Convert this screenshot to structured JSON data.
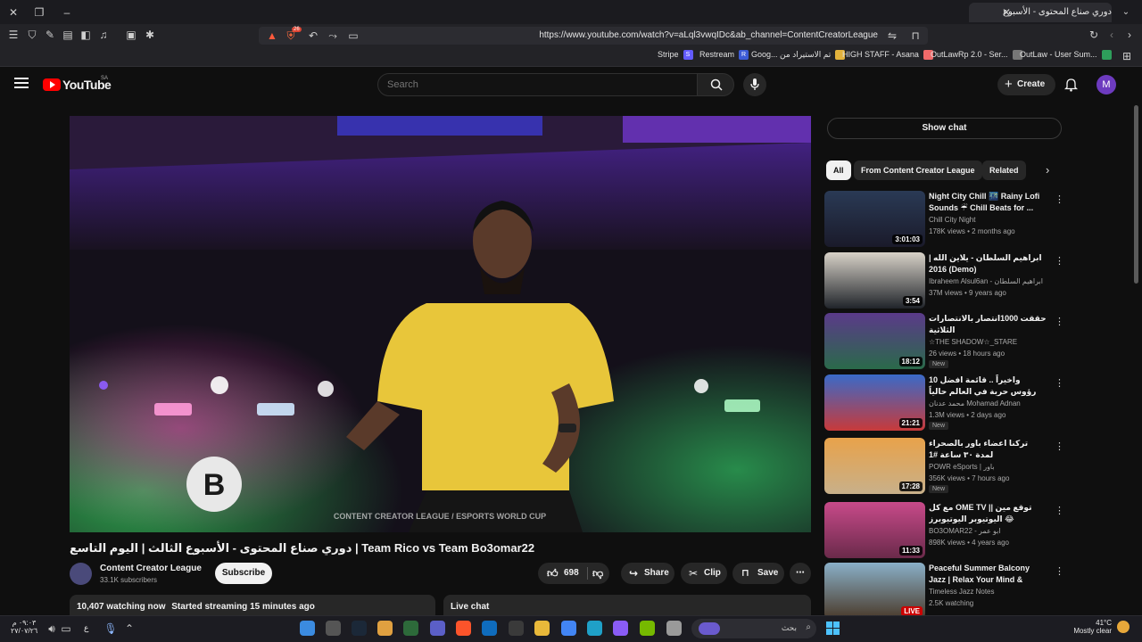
{
  "browser": {
    "tab_title": "دوري صناع المحتوى - الأسبوع",
    "url": "https://www.youtube.com/watch?v=aLql3vwqIDc&ab_channel=ContentCreatorLeague",
    "shield_badge": "26",
    "bookmarks": [
      {
        "label": "Stripe",
        "icon_letter": "S",
        "color": "#635bff"
      },
      {
        "label": "Restream",
        "icon_letter": "R",
        "color": "#3c5bd6"
      },
      {
        "label": "Goog... تم الاستيراد من",
        "icon_letter": "",
        "color": "#e2b23c"
      },
      {
        "label": "HIGH STAFF - Asana",
        "icon_letter": "",
        "color": "#f06a6a"
      },
      {
        "label": "OutLawRp 2.0 - Ser...",
        "icon_letter": "",
        "color": "#777777"
      },
      {
        "label": "OutLaw - User Sum...",
        "icon_letter": "",
        "color": "#2e9e5b"
      }
    ]
  },
  "header": {
    "logo_text": "YouTube",
    "region": "SA",
    "search_placeholder": "Search",
    "create_label": "Create",
    "avatar_letter": "M"
  },
  "video": {
    "title": "دوري صناع المحتوى - الأسبوع الثالث | اليوم التاسع | Team Rico vs Team Bo3omar22",
    "watermark": "CONTENT CREATOR LEAGUE / ESPORTS WORLD CUP"
  },
  "channel": {
    "name": "Content Creator League",
    "subs": "33.1K subscribers",
    "subscribe_label": "Subscribe"
  },
  "actions": {
    "likes": "698",
    "share": "Share",
    "clip": "Clip",
    "save": "Save"
  },
  "description": {
    "watching": "10,407 watching now",
    "started": "Started streaming 15 minutes ago"
  },
  "livechat": {
    "label": "Live chat"
  },
  "sidebar": {
    "show_chat": "Show chat",
    "chips": [
      "All",
      "From Content Creator League",
      "Related"
    ],
    "recommendations": [
      {
        "title": "Night City Chill 🌃 Rainy Lofi Sounds ☔ Chill Beats for ...",
        "channel": "Chill City Night",
        "meta": "178K views • 2 months ago",
        "duration": "3:01:03",
        "new": "",
        "thumb_top": "#2a3a55",
        "thumb_bottom": "#1a1a2a"
      },
      {
        "title": "ابراهيم السلطان - يلاين الله | 2016 (Demo)",
        "channel": "Ibraheem Alsul6an - ابراهيم السلطان",
        "meta": "37M views • 9 years ago",
        "duration": "3:54",
        "new": "",
        "thumb_top": "#d8d2c8",
        "thumb_bottom": "#20242a"
      },
      {
        "title": "حققت 1000انتصار بالانتصارات الثلاثية",
        "channel": "☆THE SHADOW☆_STARE",
        "meta": "26 views • 18 hours ago",
        "duration": "18:12",
        "new": "New",
        "thumb_top": "#5b3a8a",
        "thumb_bottom": "#2a6a4a"
      },
      {
        "title": "واخيراً .. قائمة افضل 10 رؤوس حربة في العالم حالياً 2025 !",
        "channel": "محمد عدنان Mohamad Adnan",
        "meta": "1.3M views • 2 days ago",
        "duration": "21:21",
        "new": "New",
        "thumb_top": "#3a6ac8",
        "thumb_bottom": "#c83a3a"
      },
      {
        "title": "تركنا اعضاء باور بالصحراء لمدة ٣٠ ساعة #1",
        "channel": "POWR eSports | باور",
        "meta": "356K views • 7 hours ago",
        "duration": "17:28",
        "new": "New",
        "thumb_top": "#e8a24a",
        "thumb_bottom": "#c8b08a"
      },
      {
        "title": "مع كل OME TV || توقع مين اليوتيوبر اليوتيوبرز 😂",
        "channel": "BO3OMAR22 - ابو عمر",
        "meta": "898K views • 4 years ago",
        "duration": "11:33",
        "new": "",
        "thumb_top": "#c84a8a",
        "thumb_bottom": "#6a2a4a"
      },
      {
        "title": "Peaceful Summer Balcony Jazz | Relax Your Mind & Restore ...",
        "channel": "Timeless Jazz Notes",
        "meta": "2.5K watching",
        "duration": "LIVE",
        "new": "",
        "thumb_top": "#8ab0c8",
        "thumb_bottom": "#4a3a2a"
      }
    ]
  },
  "taskbar": {
    "time": "٠٩:٠٣ م",
    "date": "٢٧/٠٧/٢٦",
    "lang": "ع",
    "search_placeholder": "بحث",
    "weather_temp": "41°C",
    "weather_desc": "Mostly clear",
    "apps": [
      {
        "name": "maps-app-icon",
        "color": "#3b8be0"
      },
      {
        "name": "clock-app-icon",
        "color": "#555"
      },
      {
        "name": "steam-icon",
        "color": "#1b2838"
      },
      {
        "name": "avatar-app-icon",
        "color": "#e0a040"
      },
      {
        "name": "xbox-icon",
        "color": "#2d6a3a"
      },
      {
        "name": "teams-icon",
        "color": "#5b5fc7"
      },
      {
        "name": "brave-icon",
        "color": "#fb542b"
      },
      {
        "name": "outlook-icon",
        "color": "#0f6cbd"
      },
      {
        "name": "store-icon",
        "color": "#3a3a3a"
      },
      {
        "name": "folder-icon",
        "color": "#e8b83a"
      },
      {
        "name": "chrome-icon",
        "color": "#4285f4"
      },
      {
        "name": "edge-icon",
        "color": "#1fa0c8"
      },
      {
        "name": "copilot-icon",
        "color": "#8a5cf6"
      },
      {
        "name": "nvidia-icon",
        "color": "#76b900"
      },
      {
        "name": "notepad-icon",
        "color": "#9a9a9a"
      }
    ]
  }
}
